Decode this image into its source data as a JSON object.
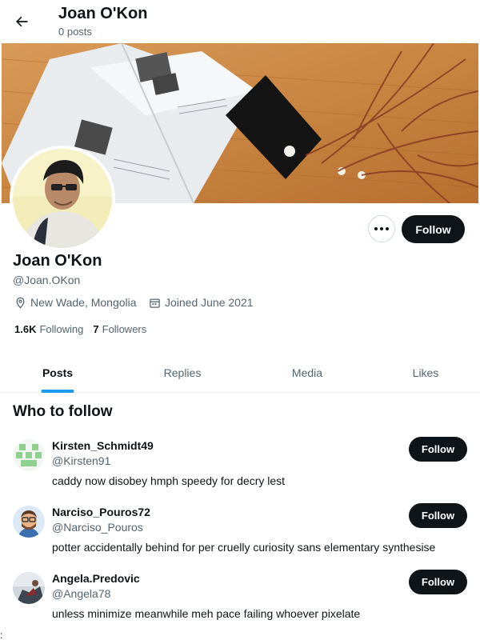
{
  "header": {
    "back_icon": "arrow-left-icon",
    "title": "Joan O'Kon",
    "subtitle": "0 posts"
  },
  "profile": {
    "name": "Joan O'Kon",
    "handle": "@Joan.OKon",
    "location": "New Wade, Mongolia",
    "joined": "Joined June 2021",
    "following_count": "1.6K",
    "following_label": "Following",
    "followers_count": "7",
    "followers_label": "Followers",
    "follow_label": "Follow",
    "more_icon": "more-horizontal-icon",
    "location_icon": "location-pin-icon",
    "calendar_icon": "calendar-icon"
  },
  "tabs": [
    {
      "label": "Posts",
      "active": true
    },
    {
      "label": "Replies",
      "active": false
    },
    {
      "label": "Media",
      "active": false
    },
    {
      "label": "Likes",
      "active": false
    }
  ],
  "who_to_follow": {
    "title": "Who to follow",
    "items": [
      {
        "name": "Kirsten_Schmidt49",
        "handle": "@Kirsten91",
        "bio": "caddy now disobey hmph speedy for decry lest",
        "follow_label": "Follow"
      },
      {
        "name": "Narciso_Pouros72",
        "handle": "@Narciso_Pouros",
        "bio": "potter accidentally behind for per cruelly curiosity sans elementary synthesise",
        "follow_label": "Follow"
      },
      {
        "name": "Angela.Predovic",
        "handle": "@Angela78",
        "bio": "unless minimize meanwhile meh pace failing whoever pixelate",
        "follow_label": "Follow"
      }
    ]
  },
  "colors": {
    "accent": "#1d9bf0",
    "text_primary": "#0f1419",
    "text_secondary": "#536471",
    "button_dark": "#0f1419"
  },
  "stray_text": ":"
}
